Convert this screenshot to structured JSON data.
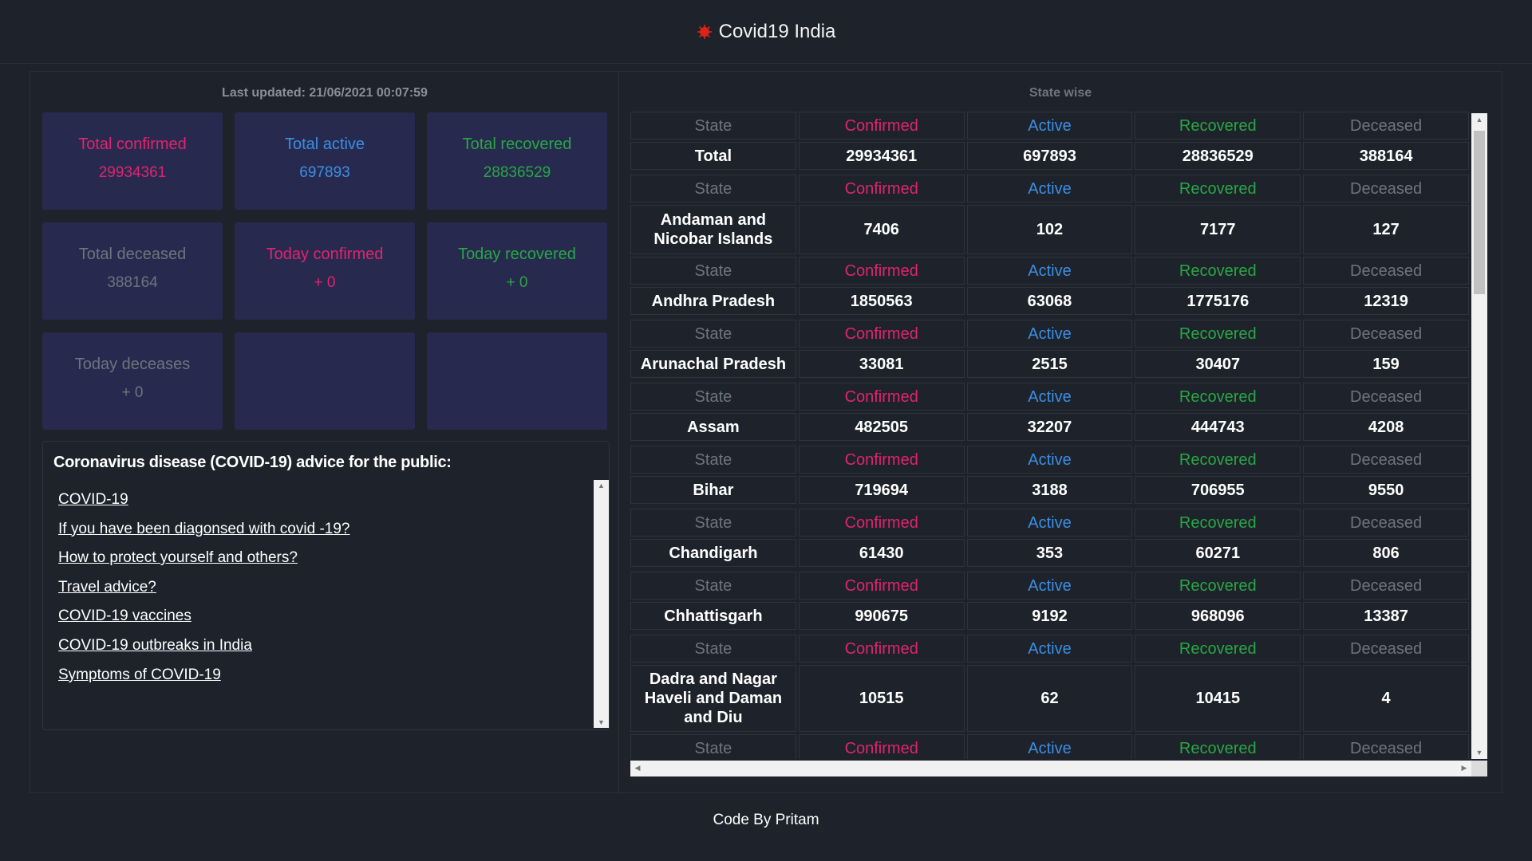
{
  "header": {
    "title": "Covid19 India",
    "icon": "virus-icon"
  },
  "colors": {
    "confirmed": "#e0246f",
    "active": "#3a8fe6",
    "recovered": "#28a745",
    "deceased": "#6c757d",
    "card_bg": "#272a4e",
    "page_bg": "#1e222a"
  },
  "left": {
    "last_updated": "Last updated: 21/06/2021 00:07:59",
    "cards": [
      {
        "label": "Total confirmed",
        "value": "29934361",
        "color": "red"
      },
      {
        "label": "Total active",
        "value": "697893",
        "color": "blue"
      },
      {
        "label": "Total recovered",
        "value": "28836529",
        "color": "green"
      },
      {
        "label": "Total deceased",
        "value": "388164",
        "color": "grey"
      },
      {
        "label": "Today confirmed",
        "value": "+ 0",
        "color": "red"
      },
      {
        "label": "Today recovered",
        "value": "+ 0",
        "color": "green"
      },
      {
        "label": "Today deceases",
        "value": "+ 0",
        "color": "grey"
      },
      {
        "label": "",
        "value": "",
        "color": "grey"
      },
      {
        "label": "",
        "value": "",
        "color": "grey"
      }
    ],
    "advice": {
      "title": "Coronavirus disease (COVID-19) advice for the public:",
      "links": [
        "COVID-19",
        "If you have been diagonsed with covid -19?",
        "How to protect yourself and others?",
        "Travel advice?",
        "COVID-19 vaccines",
        "COVID-19 outbreaks in India",
        "Symptoms of COVID-19"
      ]
    }
  },
  "right": {
    "title": "State wise",
    "header_labels": [
      "State",
      "Confirmed",
      "Active",
      "Recovered",
      "Deceased"
    ],
    "rows": [
      [
        "Total",
        "29934361",
        "697893",
        "28836529",
        "388164"
      ],
      [
        "Andaman and Nicobar Islands",
        "7406",
        "102",
        "7177",
        "127"
      ],
      [
        "Andhra Pradesh",
        "1850563",
        "63068",
        "1775176",
        "12319"
      ],
      [
        "Arunachal Pradesh",
        "33081",
        "2515",
        "30407",
        "159"
      ],
      [
        "Assam",
        "482505",
        "32207",
        "444743",
        "4208"
      ],
      [
        "Bihar",
        "719694",
        "3188",
        "706955",
        "9550"
      ],
      [
        "Chandigarh",
        "61430",
        "353",
        "60271",
        "806"
      ],
      [
        "Chhattisgarh",
        "990675",
        "9192",
        "968096",
        "13387"
      ],
      [
        "Dadra and Nagar Haveli and Daman and Diu",
        "10515",
        "62",
        "10415",
        "4"
      ]
    ]
  },
  "footer": {
    "text": "Code By Pritam"
  }
}
